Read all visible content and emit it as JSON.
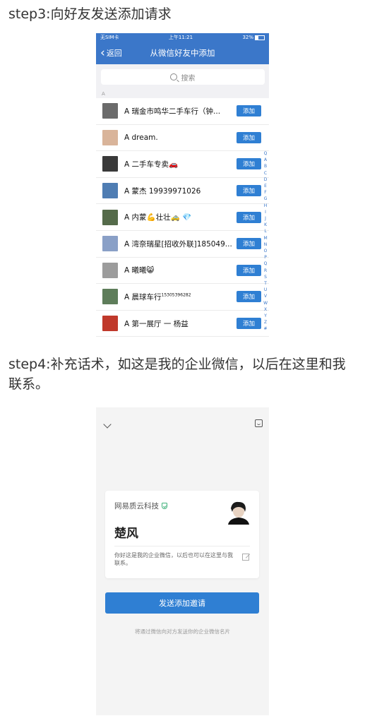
{
  "step3_title": "step3:向好友发送添加请求",
  "step4_title": "step4:补充话术，如这是我的企业微信，以后在这里和我联系。",
  "phone1": {
    "status": {
      "carrier": "无SIM卡",
      "time": "上午11:21",
      "battery": "32%"
    },
    "nav": {
      "back": "返回",
      "title": "从微信好友中添加"
    },
    "search_placeholder": "搜索",
    "section": "A",
    "add_label": "添加",
    "contacts": [
      {
        "name": "A  瑞金市鸣华二手车行（钟...",
        "color": "#6b6b6b"
      },
      {
        "name": "A  dream.",
        "color": "#d9b49a"
      },
      {
        "name": "A  二手车专卖🚗",
        "color": "#3a3a3a"
      },
      {
        "name": "A  蒙杰 19939971026",
        "color": "#4f7db3"
      },
      {
        "name": "A  内蒙💪壮壮🚕 💎",
        "color": "#556b4a"
      },
      {
        "name": "A  湾奈瑞星[招收外联]185049...",
        "color": "#8aa0c7"
      },
      {
        "name": "A  曦曦😸",
        "color": "#9c9c9c"
      },
      {
        "name": "A 晨球车行",
        "sub": "15305396282",
        "color": "#5e7d5a"
      },
      {
        "name": "A 第一展厅 一 杨益",
        "color": "#c0392b"
      }
    ],
    "index_letters": [
      "Q",
      "A",
      "B",
      "C",
      "D",
      "E",
      "F",
      "G",
      "H",
      "I",
      "J",
      "K",
      "L",
      "M",
      "N",
      "O",
      "P",
      "Q",
      "R",
      "S",
      "T",
      "U",
      "V",
      "W",
      "X",
      "Y",
      "Z",
      "#"
    ]
  },
  "phone2": {
    "company": "网易质云科技",
    "person": "楚风",
    "message": "你好这是我的企业微信，以后也可以在这里与我联系。",
    "send_button": "发送添加邀请",
    "hint": "将通过微信向对方发送你的企业微信名片"
  }
}
